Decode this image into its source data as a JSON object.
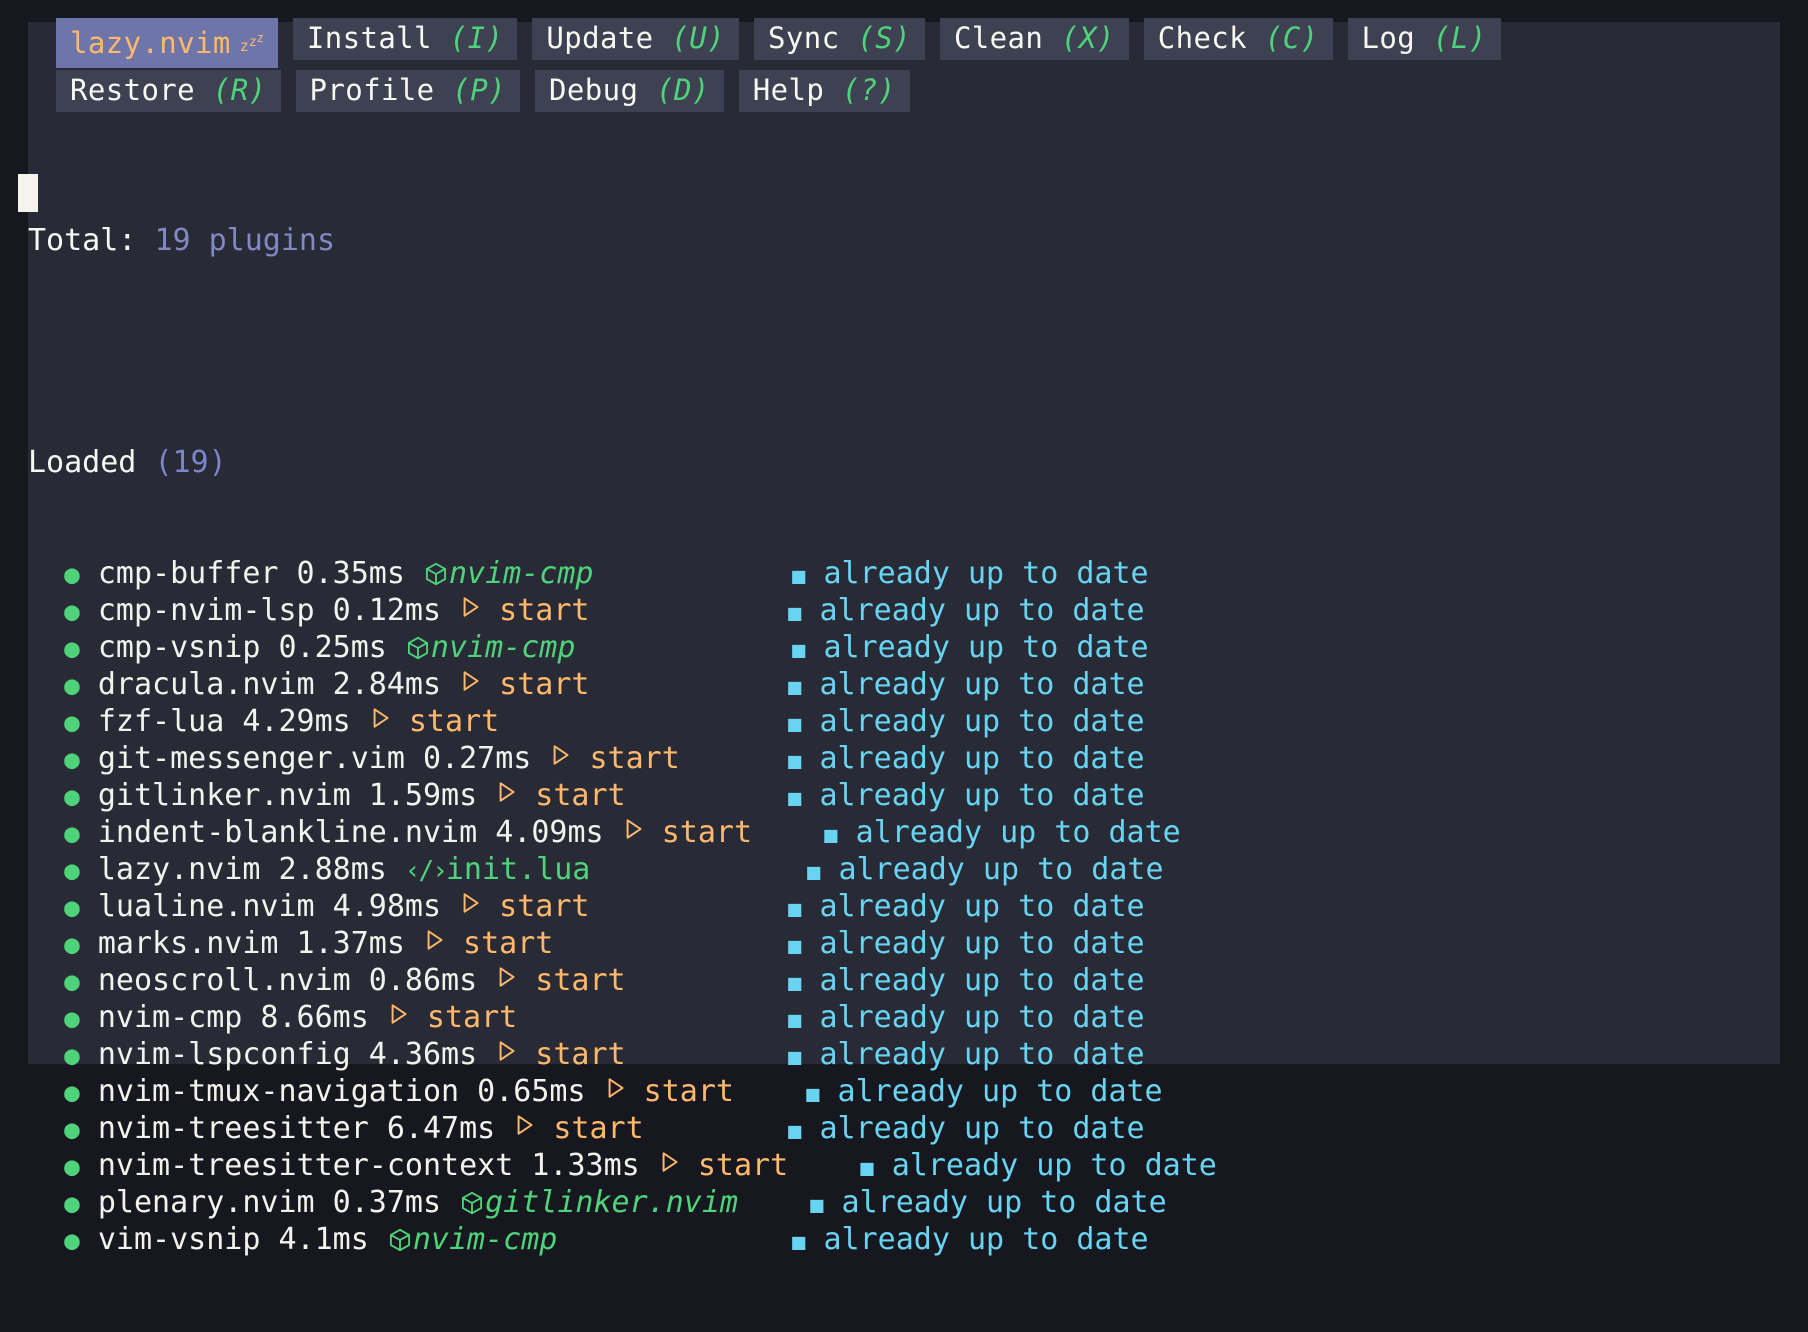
{
  "window": {
    "outer_bg": "#17181f",
    "panel_bg": "#282a36"
  },
  "tabs": {
    "row1": [
      {
        "label": "lazy.nvim",
        "key": "",
        "active": true,
        "icon": "sleep-zzz-icon"
      },
      {
        "label": "Install",
        "key": "(I)",
        "active": false
      },
      {
        "label": "Update",
        "key": "(U)",
        "active": false
      },
      {
        "label": "Sync",
        "key": "(S)",
        "active": false
      },
      {
        "label": "Clean",
        "key": "(X)",
        "active": false
      },
      {
        "label": "Check",
        "key": "(C)",
        "active": false
      },
      {
        "label": "Log",
        "key": "(L)",
        "active": false
      }
    ],
    "row2": [
      {
        "label": "Restore",
        "key": "(R)",
        "active": false
      },
      {
        "label": "Profile",
        "key": "(P)",
        "active": false
      },
      {
        "label": "Debug",
        "key": "(D)",
        "active": false
      },
      {
        "label": "Help",
        "key": "(?)",
        "active": false
      }
    ]
  },
  "summary": {
    "total_label": "Total:",
    "total_value": "19 plugins"
  },
  "section": {
    "title": "Loaded",
    "count": "(19)"
  },
  "status_text": "already up to date",
  "plugins": [
    {
      "name": "cmp-buffer",
      "time": "0.35ms",
      "reason_kind": "cube",
      "reason": "nvim-cmp",
      "status": "already up to date",
      "pad": 4
    },
    {
      "name": "cmp-nvim-lsp",
      "time": "0.12ms",
      "reason_kind": "start",
      "reason": "start",
      "status": "already up to date",
      "pad": 4
    },
    {
      "name": "cmp-vsnip",
      "time": "0.25ms",
      "reason_kind": "cube",
      "reason": "nvim-cmp",
      "status": "already up to date",
      "pad": 4
    },
    {
      "name": "dracula.nvim",
      "time": "2.84ms",
      "reason_kind": "start",
      "reason": "start",
      "status": "already up to date",
      "pad": 4
    },
    {
      "name": "fzf-lua",
      "time": "4.29ms",
      "reason_kind": "start",
      "reason": "start",
      "status": "already up to date",
      "pad": 4
    },
    {
      "name": "git-messenger.vim",
      "time": "0.27ms",
      "reason_kind": "start",
      "reason": "start",
      "status": "already up to date",
      "pad": 4
    },
    {
      "name": "gitlinker.nvim",
      "time": "1.59ms",
      "reason_kind": "start",
      "reason": "start",
      "status": "already up to date",
      "pad": 4
    },
    {
      "name": "indent-blankline.nvim",
      "time": "4.09ms",
      "reason_kind": "start",
      "reason": "start",
      "status": "already up to date",
      "pad": 4
    },
    {
      "name": "lazy.nvim",
      "time": "2.88ms",
      "reason_kind": "code",
      "reason": "init.lua",
      "status": "already up to date",
      "pad": 4
    },
    {
      "name": "lualine.nvim",
      "time": "4.98ms",
      "reason_kind": "start",
      "reason": "start",
      "status": "already up to date",
      "pad": 4
    },
    {
      "name": "marks.nvim",
      "time": "1.37ms",
      "reason_kind": "start",
      "reason": "start",
      "status": "already up to date",
      "pad": 4
    },
    {
      "name": "neoscroll.nvim",
      "time": "0.86ms",
      "reason_kind": "start",
      "reason": "start",
      "status": "already up to date",
      "pad": 4
    },
    {
      "name": "nvim-cmp",
      "time": "8.66ms",
      "reason_kind": "start",
      "reason": "start",
      "status": "already up to date",
      "pad": 4
    },
    {
      "name": "nvim-lspconfig",
      "time": "4.36ms",
      "reason_kind": "start",
      "reason": "start",
      "status": "already up to date",
      "pad": 4
    },
    {
      "name": "nvim-tmux-navigation",
      "time": "0.65ms",
      "reason_kind": "start",
      "reason": "start",
      "status": "already up to date",
      "pad": 4
    },
    {
      "name": "nvim-treesitter",
      "time": "6.47ms",
      "reason_kind": "start",
      "reason": "start",
      "status": "already up to date",
      "pad": 4
    },
    {
      "name": "nvim-treesitter-context",
      "time": "1.33ms",
      "reason_kind": "start",
      "reason": "start",
      "status": "already up to date",
      "pad": 4
    },
    {
      "name": "plenary.nvim",
      "time": "0.37ms",
      "reason_kind": "cube",
      "reason": "gitlinker.nvim",
      "status": "already up to date",
      "pad": 4
    },
    {
      "name": "vim-vsnip",
      "time": "4.1ms",
      "reason_kind": "cube",
      "reason": "nvim-cmp",
      "status": "already up to date",
      "pad": 4
    }
  ],
  "colors": {
    "accent_orange": "#ffb86c",
    "accent_green": "#4fd37a",
    "accent_cyan": "#68d4f1",
    "accent_purple": "#6e75a8",
    "muted_blue": "#8189c4",
    "fg": "#f8f8f2"
  }
}
